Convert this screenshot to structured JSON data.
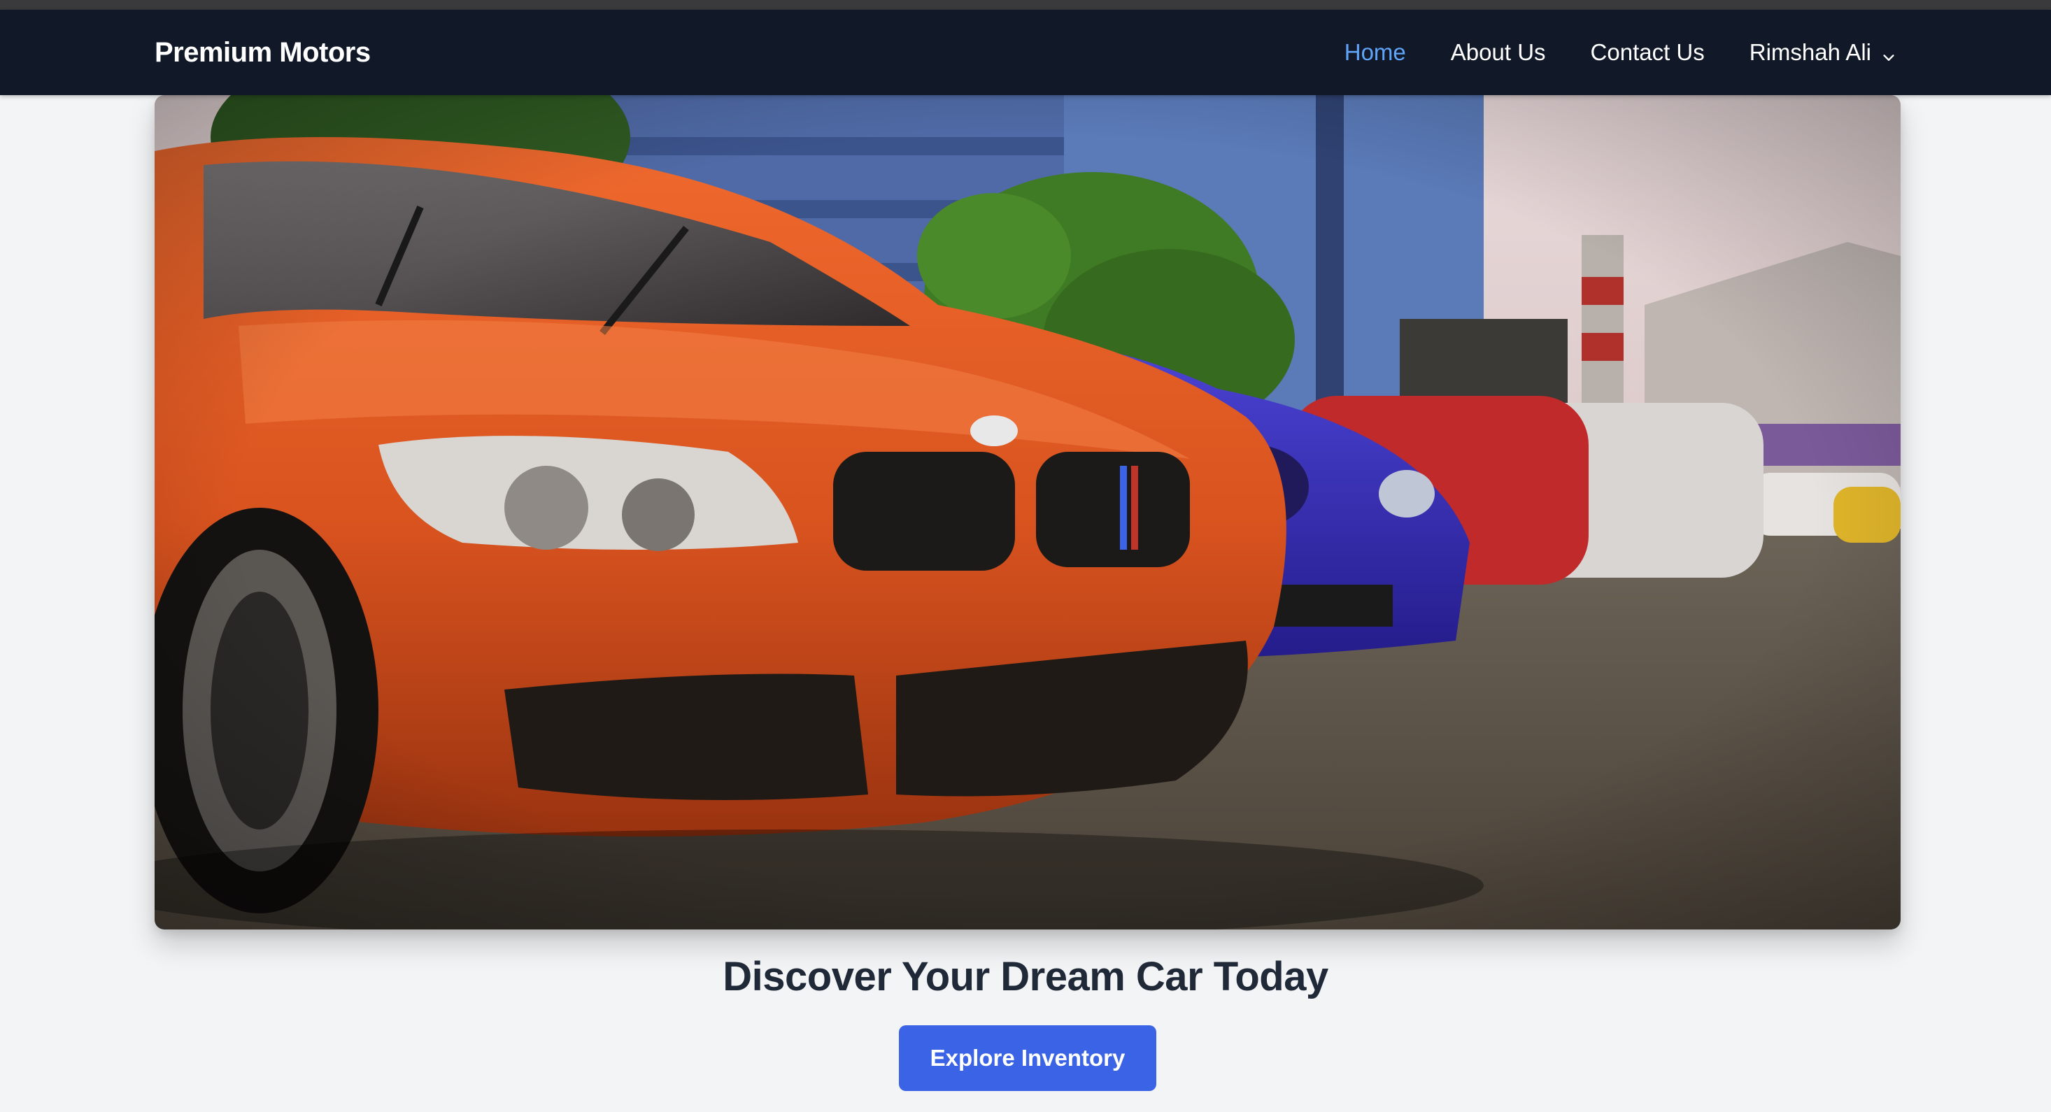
{
  "navbar": {
    "brand": "Premium Motors",
    "links": [
      {
        "label": "Home",
        "active": true
      },
      {
        "label": "About Us",
        "active": false
      },
      {
        "label": "Contact Us",
        "active": false
      }
    ],
    "user_name": "Rimshah Ali",
    "user_menu_icon": "chevron-down-icon"
  },
  "hero": {
    "headline": "Discover Your Dream Car Today",
    "cta_label": "Explore Inventory"
  },
  "colors": {
    "navbar_bg": "#111827",
    "active_link": "#60a5fa",
    "page_bg": "#f3f4f6",
    "headline": "#1f2937",
    "cta_bg": "#3b63e5"
  }
}
